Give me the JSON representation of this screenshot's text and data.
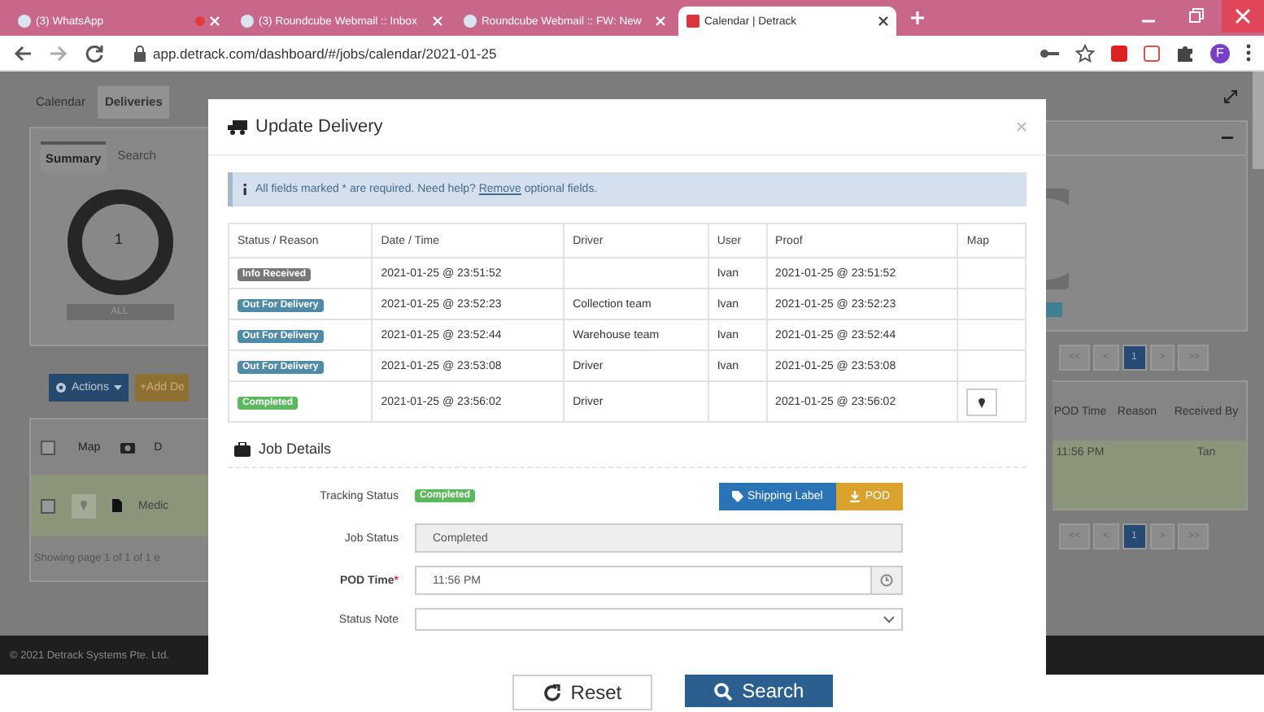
{
  "browser": {
    "tabs": [
      {
        "title": "(3) WhatsApp",
        "selected": false,
        "audio": true
      },
      {
        "title": "(3) Roundcube Webmail :: Inbox",
        "selected": false,
        "audio": false
      },
      {
        "title": "Roundcube Webmail :: FW: New",
        "selected": false,
        "audio": false
      },
      {
        "title": "Calendar | Detrack",
        "selected": true,
        "audio": false
      }
    ],
    "url": "app.detrack.com/dashboard/#/jobs/calendar/2021-01-25",
    "profile_initial": "F"
  },
  "background": {
    "nav_tabs": [
      {
        "label": "Calendar",
        "selected": false
      },
      {
        "label": "Deliveries",
        "selected": true
      }
    ],
    "summary_tabs": [
      {
        "label": "Summary",
        "selected": true
      },
      {
        "label": "Search",
        "selected": false
      }
    ],
    "donut_value": "1",
    "filter_label": "ALL",
    "actions_button": "Actions",
    "add_button": "+Add De",
    "header_checkbox": {
      "checked": false
    },
    "row_checkbox": {
      "checked": false
    },
    "columns": [
      "Map",
      "D"
    ],
    "row_cell": "Medic",
    "pager_text": "Showing page 1 of 1 of 1 e",
    "footer": "© 2021 Detrack Systems Pte. Ltd.",
    "pager_top": [
      {
        "label": "<<",
        "selected": false
      },
      {
        "label": "<",
        "selected": false
      },
      {
        "label": "1",
        "selected": true
      },
      {
        "label": ">",
        "selected": false
      },
      {
        "label": ">>",
        "selected": false
      }
    ],
    "pager_bottom": [
      {
        "label": "<<",
        "selected": false
      },
      {
        "label": "<",
        "selected": false
      },
      {
        "label": "1",
        "selected": true
      },
      {
        "label": ">",
        "selected": false
      },
      {
        "label": ">>",
        "selected": false
      }
    ],
    "right_columns": [
      "POD Time",
      "Reason",
      "Received By"
    ],
    "right_row": {
      "pod_time": "11:56 PM",
      "received_by": "Tan"
    }
  },
  "modal": {
    "title": "Update Delivery",
    "info": {
      "before": "All fields marked * are required. Need help? ",
      "link": "Remove",
      "after": " optional fields."
    },
    "history": {
      "columns": [
        "Status / Reason",
        "Date / Time",
        "Driver",
        "User",
        "Proof",
        "Map"
      ],
      "rows": [
        {
          "status": "Info Received",
          "kind": "info",
          "date_time": "2021-01-25 @ 23:51:52",
          "user": "Ivan",
          "proof": "2021-01-25 @ 23:51:52",
          "map_pin": false
        },
        {
          "status": "Out For Delivery",
          "kind": "out",
          "date_time": "2021-01-25 @ 23:52:23",
          "driver": "Collection team",
          "user": "Ivan",
          "proof": "2021-01-25 @ 23:52:23",
          "map_pin": false
        },
        {
          "status": "Out For Delivery",
          "kind": "out",
          "date_time": "2021-01-25 @ 23:52:44",
          "driver": "Warehouse team",
          "user": "Ivan",
          "proof": "2021-01-25 @ 23:52:44",
          "map_pin": false
        },
        {
          "status": "Out For Delivery",
          "kind": "out",
          "date_time": "2021-01-25 @ 23:53:08",
          "driver": "Driver",
          "user": "Ivan",
          "proof": "2021-01-25 @ 23:53:08",
          "map_pin": false
        },
        {
          "status": "Completed",
          "kind": "completed",
          "date_time": "2021-01-25 @ 23:56:02",
          "driver": "Driver",
          "proof": "2021-01-25 @ 23:56:02",
          "map_pin": true
        }
      ]
    },
    "job_details": {
      "title": "Job Details",
      "tracking_status": {
        "label": "Tracking Status",
        "badge": "Completed",
        "kind": "completed"
      },
      "buttons": [
        {
          "label": "Shipping Label",
          "kind": "label"
        },
        {
          "label": "POD",
          "kind": "download"
        }
      ],
      "job_status": {
        "label": "Job Status",
        "value": "Completed",
        "disabled": true
      },
      "pod_time": {
        "label": "POD Time",
        "required_mark": "*",
        "value": "11:56 PM"
      },
      "status_note": {
        "label": "Status Note"
      }
    }
  },
  "bottom_buttons": [
    {
      "label": "Reset",
      "kind": "reset"
    },
    {
      "label": "Search",
      "kind": "search"
    }
  ]
}
